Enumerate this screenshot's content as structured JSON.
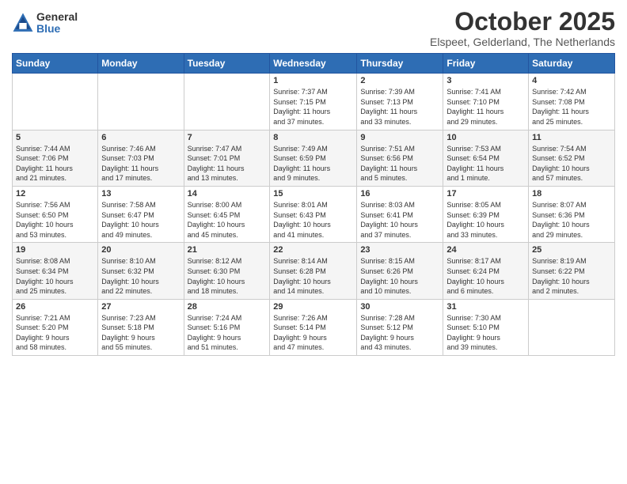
{
  "logo": {
    "general": "General",
    "blue": "Blue"
  },
  "header": {
    "title": "October 2025",
    "subtitle": "Elspeet, Gelderland, The Netherlands"
  },
  "weekdays": [
    "Sunday",
    "Monday",
    "Tuesday",
    "Wednesday",
    "Thursday",
    "Friday",
    "Saturday"
  ],
  "weeks": [
    [
      {
        "day": "",
        "info": ""
      },
      {
        "day": "",
        "info": ""
      },
      {
        "day": "",
        "info": ""
      },
      {
        "day": "1",
        "info": "Sunrise: 7:37 AM\nSunset: 7:15 PM\nDaylight: 11 hours\nand 37 minutes."
      },
      {
        "day": "2",
        "info": "Sunrise: 7:39 AM\nSunset: 7:13 PM\nDaylight: 11 hours\nand 33 minutes."
      },
      {
        "day": "3",
        "info": "Sunrise: 7:41 AM\nSunset: 7:10 PM\nDaylight: 11 hours\nand 29 minutes."
      },
      {
        "day": "4",
        "info": "Sunrise: 7:42 AM\nSunset: 7:08 PM\nDaylight: 11 hours\nand 25 minutes."
      }
    ],
    [
      {
        "day": "5",
        "info": "Sunrise: 7:44 AM\nSunset: 7:06 PM\nDaylight: 11 hours\nand 21 minutes."
      },
      {
        "day": "6",
        "info": "Sunrise: 7:46 AM\nSunset: 7:03 PM\nDaylight: 11 hours\nand 17 minutes."
      },
      {
        "day": "7",
        "info": "Sunrise: 7:47 AM\nSunset: 7:01 PM\nDaylight: 11 hours\nand 13 minutes."
      },
      {
        "day": "8",
        "info": "Sunrise: 7:49 AM\nSunset: 6:59 PM\nDaylight: 11 hours\nand 9 minutes."
      },
      {
        "day": "9",
        "info": "Sunrise: 7:51 AM\nSunset: 6:56 PM\nDaylight: 11 hours\nand 5 minutes."
      },
      {
        "day": "10",
        "info": "Sunrise: 7:53 AM\nSunset: 6:54 PM\nDaylight: 11 hours\nand 1 minute."
      },
      {
        "day": "11",
        "info": "Sunrise: 7:54 AM\nSunset: 6:52 PM\nDaylight: 10 hours\nand 57 minutes."
      }
    ],
    [
      {
        "day": "12",
        "info": "Sunrise: 7:56 AM\nSunset: 6:50 PM\nDaylight: 10 hours\nand 53 minutes."
      },
      {
        "day": "13",
        "info": "Sunrise: 7:58 AM\nSunset: 6:47 PM\nDaylight: 10 hours\nand 49 minutes."
      },
      {
        "day": "14",
        "info": "Sunrise: 8:00 AM\nSunset: 6:45 PM\nDaylight: 10 hours\nand 45 minutes."
      },
      {
        "day": "15",
        "info": "Sunrise: 8:01 AM\nSunset: 6:43 PM\nDaylight: 10 hours\nand 41 minutes."
      },
      {
        "day": "16",
        "info": "Sunrise: 8:03 AM\nSunset: 6:41 PM\nDaylight: 10 hours\nand 37 minutes."
      },
      {
        "day": "17",
        "info": "Sunrise: 8:05 AM\nSunset: 6:39 PM\nDaylight: 10 hours\nand 33 minutes."
      },
      {
        "day": "18",
        "info": "Sunrise: 8:07 AM\nSunset: 6:36 PM\nDaylight: 10 hours\nand 29 minutes."
      }
    ],
    [
      {
        "day": "19",
        "info": "Sunrise: 8:08 AM\nSunset: 6:34 PM\nDaylight: 10 hours\nand 25 minutes."
      },
      {
        "day": "20",
        "info": "Sunrise: 8:10 AM\nSunset: 6:32 PM\nDaylight: 10 hours\nand 22 minutes."
      },
      {
        "day": "21",
        "info": "Sunrise: 8:12 AM\nSunset: 6:30 PM\nDaylight: 10 hours\nand 18 minutes."
      },
      {
        "day": "22",
        "info": "Sunrise: 8:14 AM\nSunset: 6:28 PM\nDaylight: 10 hours\nand 14 minutes."
      },
      {
        "day": "23",
        "info": "Sunrise: 8:15 AM\nSunset: 6:26 PM\nDaylight: 10 hours\nand 10 minutes."
      },
      {
        "day": "24",
        "info": "Sunrise: 8:17 AM\nSunset: 6:24 PM\nDaylight: 10 hours\nand 6 minutes."
      },
      {
        "day": "25",
        "info": "Sunrise: 8:19 AM\nSunset: 6:22 PM\nDaylight: 10 hours\nand 2 minutes."
      }
    ],
    [
      {
        "day": "26",
        "info": "Sunrise: 7:21 AM\nSunset: 5:20 PM\nDaylight: 9 hours\nand 58 minutes."
      },
      {
        "day": "27",
        "info": "Sunrise: 7:23 AM\nSunset: 5:18 PM\nDaylight: 9 hours\nand 55 minutes."
      },
      {
        "day": "28",
        "info": "Sunrise: 7:24 AM\nSunset: 5:16 PM\nDaylight: 9 hours\nand 51 minutes."
      },
      {
        "day": "29",
        "info": "Sunrise: 7:26 AM\nSunset: 5:14 PM\nDaylight: 9 hours\nand 47 minutes."
      },
      {
        "day": "30",
        "info": "Sunrise: 7:28 AM\nSunset: 5:12 PM\nDaylight: 9 hours\nand 43 minutes."
      },
      {
        "day": "31",
        "info": "Sunrise: 7:30 AM\nSunset: 5:10 PM\nDaylight: 9 hours\nand 39 minutes."
      },
      {
        "day": "",
        "info": ""
      }
    ]
  ]
}
